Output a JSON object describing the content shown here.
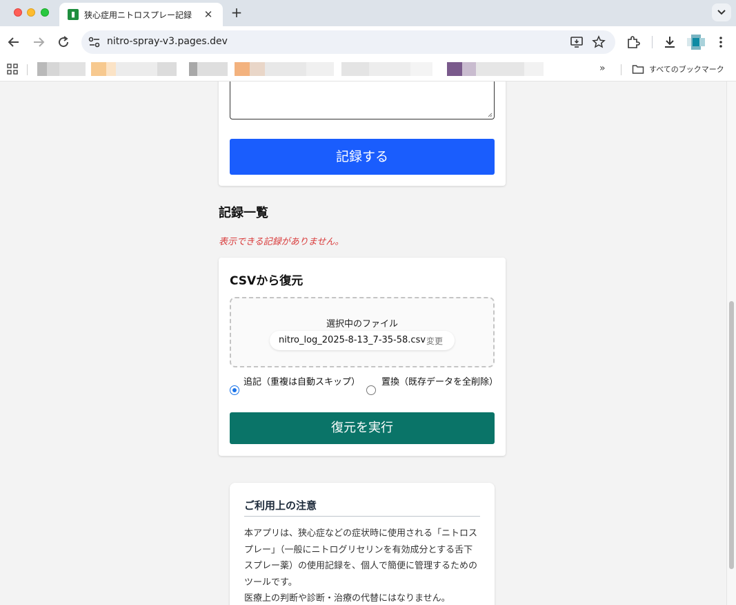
{
  "browser": {
    "tab_title": "狭心症用ニトロスプレー記録",
    "tab_favicon_glyph": "▮",
    "url": "nitro-spray-v3.pages.dev",
    "all_bookmarks_label": "すべてのブックマーク",
    "bookmarks_more": "»"
  },
  "form": {
    "record_button": "記録する"
  },
  "records": {
    "title": "記録一覧",
    "empty_message": "表示できる記録がありません。"
  },
  "csv_restore": {
    "title": "CSVから復元",
    "selected_file_label": "選択中のファイル",
    "file_name": "nitro_log_2025-8-13_7-35-58.csv",
    "change_label": "変更",
    "mode_append_label": "追記（重複は自動スキップ）",
    "mode_append_selected": true,
    "mode_replace_label": "置換（既存データを全削除）",
    "mode_replace_selected": false,
    "restore_button": "復元を実行"
  },
  "notice": {
    "title": "ご利用上の注意",
    "paragraph1": "本アプリは、狭心症などの症状時に使用される「ニトロスプレー」（一般にニトログリセリンを有効成分とする舌下スプレー薬）の使用記録を、個人で簡便に管理するためのツールです。",
    "paragraph2": "医療上の判断や診断・治療の代替にはなりません。"
  },
  "colors": {
    "record_button": "#1a5dfd",
    "restore_button": "#0a7468",
    "empty_message": "#d93a3a",
    "radio_accent": "#1a73e8"
  },
  "icons": [
    "back-icon",
    "forward-icon",
    "reload-icon",
    "site-settings-icon",
    "install-app-icon",
    "bookmark-star-icon",
    "extensions-icon",
    "download-icon",
    "menu-icon",
    "apps-icon",
    "folder-icon",
    "tab-search-icon",
    "close-icon",
    "plus-icon"
  ]
}
